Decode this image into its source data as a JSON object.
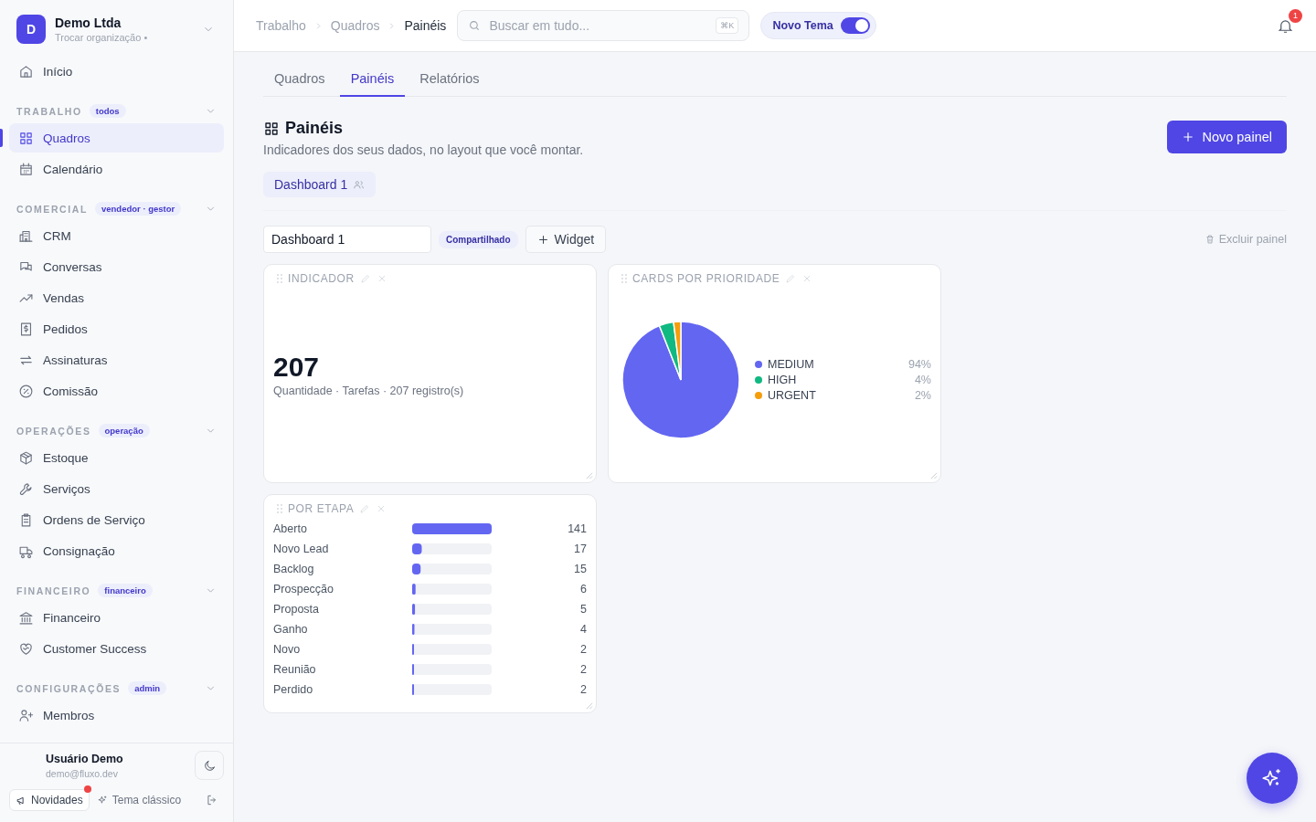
{
  "org": {
    "initial": "D",
    "name": "Demo Ltda",
    "subtitle": "Trocar organização •"
  },
  "nav_top": [
    {
      "label": "Início",
      "selected": false
    }
  ],
  "sections": [
    {
      "label": "TRABALHO",
      "badge": "todos",
      "expanded": true,
      "items": [
        {
          "label": "Quadros",
          "selected": true
        },
        {
          "label": "Calendário",
          "selected": false
        }
      ]
    },
    {
      "label": "COMERCIAL",
      "badge": "vendedor · gestor",
      "expanded": true,
      "items": [
        {
          "label": "CRM",
          "selected": false
        },
        {
          "label": "Conversas",
          "selected": false
        },
        {
          "label": "Vendas",
          "selected": false
        },
        {
          "label": "Pedidos",
          "selected": false
        },
        {
          "label": "Assinaturas",
          "selected": false
        },
        {
          "label": "Comissão",
          "selected": false
        }
      ]
    },
    {
      "label": "OPERAÇÕES",
      "badge": "operação",
      "expanded": true,
      "items": [
        {
          "label": "Estoque",
          "selected": false
        },
        {
          "label": "Serviços",
          "selected": false
        },
        {
          "label": "Ordens de Serviço",
          "selected": false
        },
        {
          "label": "Consignação",
          "selected": false
        }
      ]
    },
    {
      "label": "FINANCEIRO",
      "badge": "financeiro",
      "expanded": true,
      "items": [
        {
          "label": "Financeiro",
          "selected": false
        },
        {
          "label": "Customer Success",
          "selected": false
        }
      ]
    },
    {
      "label": "CONFIGURAÇÕES",
      "badge": "admin",
      "expanded": true,
      "items": [
        {
          "label": "Membros",
          "selected": false
        }
      ]
    }
  ],
  "user": {
    "name": "Usuário Demo",
    "email": "demo@fluxo.dev"
  },
  "footer": {
    "news": "Novidades",
    "news_unread": true,
    "theme": "Tema clássico"
  },
  "breadcrumb": [
    "Trabalho",
    "Quadros",
    "Painéis"
  ],
  "search": {
    "placeholder": "Buscar em tudo...",
    "shortcut": "⌘K"
  },
  "theme_toggle": {
    "label": "Novo Tema",
    "on": true
  },
  "notifications": {
    "count": "1"
  },
  "tabs": [
    {
      "label": "Quadros",
      "selected": false
    },
    {
      "label": "Painéis",
      "selected": true
    },
    {
      "label": "Relatórios",
      "selected": false
    }
  ],
  "page": {
    "title": "Painéis",
    "subtitle": "Indicadores dos seus dados, no layout que você montar.",
    "new_button": "Novo painel"
  },
  "dashboards": [
    {
      "label": "Dashboard 1",
      "selected": true,
      "shared": true
    }
  ],
  "toolbar": {
    "name_value": "Dashboard 1",
    "shared_badge": "Compartilhado",
    "widget_button": "Widget",
    "delete": "Excluir painel"
  },
  "widgets": [
    {
      "kind": "indicator",
      "title": "INDICADOR",
      "value": "207",
      "caption": "Quantidade · Tarefas · 207 registro(s)"
    },
    {
      "kind": "pie",
      "title": "CARDS POR PRIORIDADE",
      "chart_data": {
        "type": "pie",
        "categories": [
          "MEDIUM",
          "HIGH",
          "URGENT"
        ],
        "colors": [
          "#6366f1",
          "#10b981",
          "#f59e0b"
        ],
        "series": [
          {
            "values": [
              94,
              4,
              2
            ]
          }
        ],
        "value_labels": [
          "94%",
          "4%",
          "2%"
        ],
        "legend": true
      }
    },
    {
      "kind": "bars",
      "title": "POR ETAPA",
      "chart_data": {
        "type": "bar",
        "orientation": "horizontal",
        "categories": [
          "Aberto",
          "Novo Lead",
          "Backlog",
          "Prospecção",
          "Proposta",
          "Ganho",
          "Novo",
          "Reunião",
          "Perdido"
        ],
        "series": [
          {
            "color": "#6366f1",
            "values": [
              141,
              17,
              15,
              6,
              5,
              4,
              2,
              2,
              2
            ]
          }
        ],
        "data_labels": true
      }
    }
  ]
}
